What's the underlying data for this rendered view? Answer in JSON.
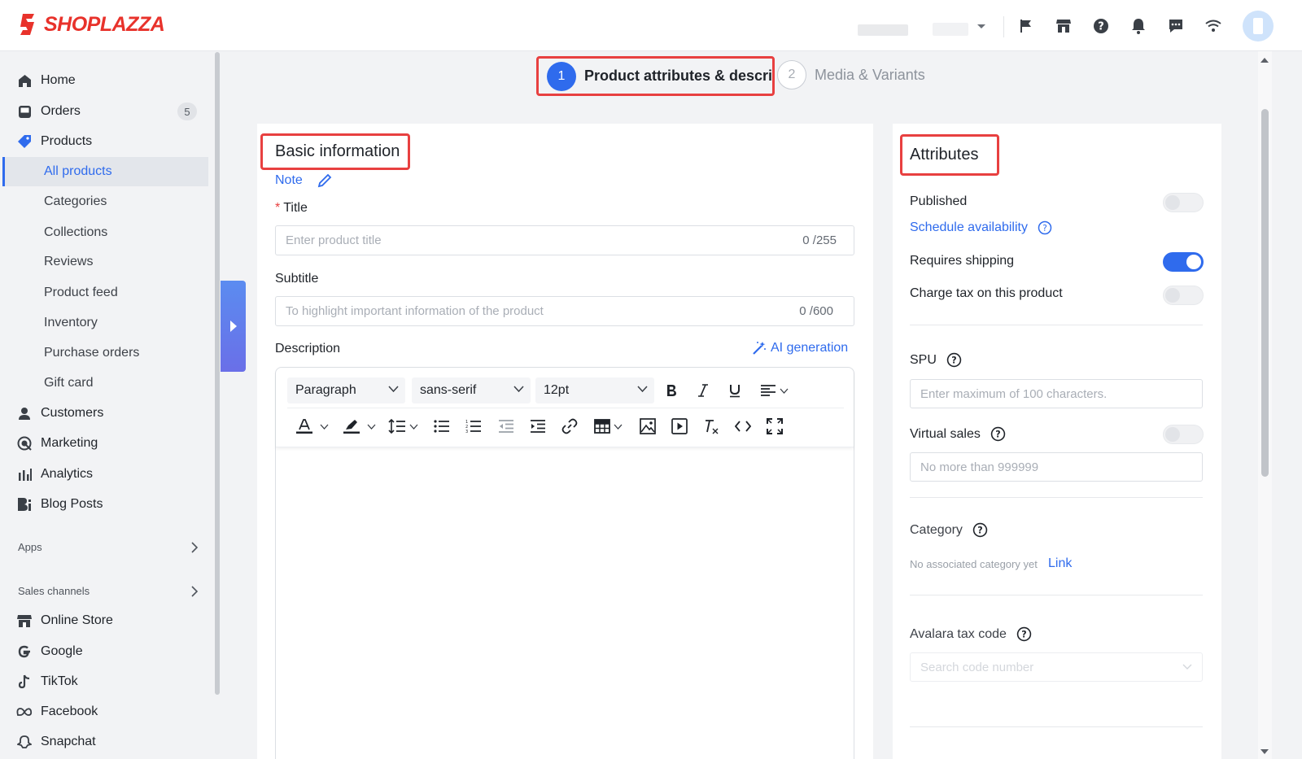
{
  "brand": {
    "name": "SHOPLAZZA",
    "color": "#e8322b"
  },
  "colors": {
    "accent": "#2f6bed",
    "highlight": "#e84040"
  },
  "topbar": {
    "icons": [
      "flag-icon",
      "store-icon",
      "help-icon",
      "bell-icon",
      "message-icon",
      "wifi-icon"
    ]
  },
  "sidebar": {
    "items": [
      {
        "label": "Home",
        "icon": "home-icon"
      },
      {
        "label": "Orders",
        "icon": "inbox-icon",
        "badge": "5"
      },
      {
        "label": "Products",
        "icon": "tag-icon"
      },
      {
        "label": "Customers",
        "icon": "person-icon"
      },
      {
        "label": "Marketing",
        "icon": "target-icon"
      },
      {
        "label": "Analytics",
        "icon": "bar-chart-icon"
      },
      {
        "label": "Blog Posts",
        "icon": "blog-icon"
      }
    ],
    "product_sub": [
      "All products",
      "Categories",
      "Collections",
      "Reviews",
      "Product feed",
      "Inventory",
      "Purchase orders",
      "Gift card"
    ],
    "active_sub": "All products",
    "apps_label": "Apps",
    "sales_channels_label": "Sales channels",
    "channels": [
      {
        "label": "Online Store",
        "icon": "store-icon"
      },
      {
        "label": "Google",
        "icon": "google-icon"
      },
      {
        "label": "TikTok",
        "icon": "tiktok-icon"
      },
      {
        "label": "Facebook",
        "icon": "meta-icon"
      },
      {
        "label": "Snapchat",
        "icon": "ghost-icon"
      }
    ]
  },
  "steps": [
    {
      "number": "1",
      "label": "Product attributes & descri",
      "active": true
    },
    {
      "number": "2",
      "label": "Media & Variants",
      "active": false
    }
  ],
  "basic": {
    "heading": "Basic information",
    "note_label": "Note",
    "title_label": "Title",
    "title_placeholder": "Enter product title",
    "title_counter": "0 /255",
    "subtitle_label": "Subtitle",
    "subtitle_placeholder": "To highlight important information of the product",
    "subtitle_counter": "0 /600",
    "description_label": "Description",
    "ai_generation": "AI generation"
  },
  "editor": {
    "block_format": "Paragraph",
    "font_family": "sans-serif",
    "font_size": "12pt"
  },
  "attributes": {
    "heading": "Attributes",
    "published_label": "Published",
    "published": false,
    "schedule_link": "Schedule availability",
    "requires_shipping_label": "Requires shipping",
    "requires_shipping": true,
    "charge_tax_label": "Charge tax on this product",
    "charge_tax": false,
    "spu_label": "SPU",
    "spu_placeholder": "Enter maximum of 100 characters.",
    "virtual_sales_label": "Virtual sales",
    "virtual_sales": false,
    "virtual_sales_placeholder": "No more than 999999",
    "category_label": "Category",
    "category_empty": "No associated category yet",
    "category_link": "Link",
    "avalara_label": "Avalara tax code",
    "avalara_placeholder": "Search code number"
  }
}
